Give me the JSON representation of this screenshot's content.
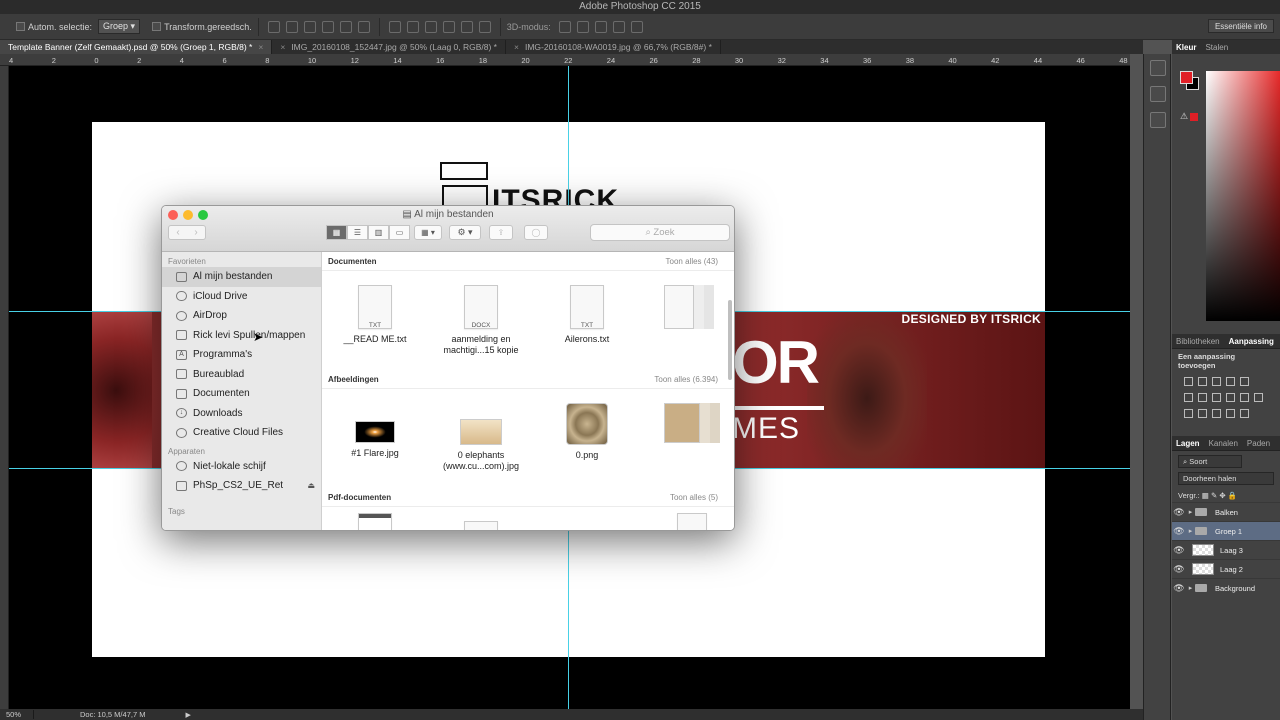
{
  "app": {
    "title": "Adobe Photoshop CC 2015"
  },
  "options": {
    "auto_select_label": "Autom. selectie:",
    "auto_select_value": "Groep",
    "transform_label": "Transform.gereedsch.",
    "mode3d_label": "3D-modus:",
    "workspace_label": "Essentiële info"
  },
  "tabs": [
    {
      "label": "Template Banner (Zelf Gemaakt).psd @ 50% (Groep 1, RGB/8) *"
    },
    {
      "label": "IMG_20160108_152447.jpg @ 50% (Laag 0, RGB/8) *"
    },
    {
      "label": "IMG-20160108-WA0019.jpg @ 66,7% (RGB/8#) *"
    }
  ],
  "ruler_ticks": [
    "4",
    "2",
    "0",
    "2",
    "4",
    "6",
    "8",
    "10",
    "12",
    "14",
    "16",
    "18",
    "20",
    "22",
    "24",
    "26",
    "28",
    "30",
    "32",
    "34",
    "36",
    "38",
    "40",
    "42",
    "44",
    "46",
    "48"
  ],
  "artboard": {
    "logo_text": "ITSRICK",
    "designed_by": "DESIGNED BY ITSRICK",
    "big_text": "OR",
    "small_text": "MES"
  },
  "status": {
    "zoom": "50%",
    "doc_info": "Doc: 10,5 M/47,7 M"
  },
  "panels": {
    "color_tabs": [
      "Kleur",
      "Stalen"
    ],
    "warning_symbol": "⚠",
    "adjust_tabs": [
      "Bibliotheken",
      "Aanpassing"
    ],
    "adjust_title": "Een aanpassing toevoegen",
    "layer_tabs": [
      "Lagen",
      "Kanalen",
      "Paden"
    ],
    "kind_filter": "Soort",
    "blend_mode": "Doorheen halen",
    "lock_label": "Vergr.:",
    "layers": [
      {
        "name": "Balken",
        "type": "group",
        "selected": false
      },
      {
        "name": "Groep 1",
        "type": "group",
        "selected": true
      },
      {
        "name": "Laag 3",
        "type": "layer",
        "selected": false
      },
      {
        "name": "Laag 2",
        "type": "layer",
        "selected": false
      },
      {
        "name": "Background",
        "type": "group",
        "selected": false
      }
    ],
    "colors": {
      "foreground": "#e01f26",
      "background": "#000000"
    }
  },
  "finder": {
    "title": "Al mijn bestanden",
    "search_placeholder": "Zoek",
    "sidebar": {
      "favorites_header": "Favorieten",
      "favorites": [
        {
          "label": "Al mijn bestanden",
          "icon": "all-files-icon",
          "selected": true
        },
        {
          "label": "iCloud Drive",
          "icon": "cloud-icon"
        },
        {
          "label": "AirDrop",
          "icon": "airdrop-icon"
        },
        {
          "label": "Rick levi Spullen/mappen",
          "icon": "folder-icon"
        },
        {
          "label": "Programma's",
          "icon": "applications-icon"
        },
        {
          "label": "Bureaublad",
          "icon": "desktop-icon"
        },
        {
          "label": "Documenten",
          "icon": "documents-icon"
        },
        {
          "label": "Downloads",
          "icon": "downloads-icon"
        },
        {
          "label": "Creative Cloud Files",
          "icon": "creative-cloud-icon"
        }
      ],
      "devices_header": "Apparaten",
      "devices": [
        {
          "label": "Niet-lokale schijf",
          "icon": "disc-icon"
        },
        {
          "label": "PhSp_CS2_UE_Ret",
          "icon": "drive-icon",
          "eject": "⏏"
        }
      ],
      "tags_header": "Tags"
    },
    "sections": [
      {
        "name": "Documenten",
        "more": "Toon alles (43)",
        "files": [
          {
            "name": "__READ ME.txt",
            "kind": "TXT"
          },
          {
            "name": "aanmelding en machtigi...15 kopie",
            "kind": "DOCX"
          },
          {
            "name": "Ailerons.txt",
            "kind": "TXT"
          }
        ]
      },
      {
        "name": "Afbeeldingen",
        "more": "Toon alles (6.394)",
        "files": [
          {
            "name": "#1 Flare.jpg"
          },
          {
            "name": "0 elephants (www.cu...com).jpg"
          },
          {
            "name": "0.png"
          }
        ]
      },
      {
        "name": "Pdf-documenten",
        "more": "Toon alles (5)",
        "files": []
      }
    ]
  }
}
